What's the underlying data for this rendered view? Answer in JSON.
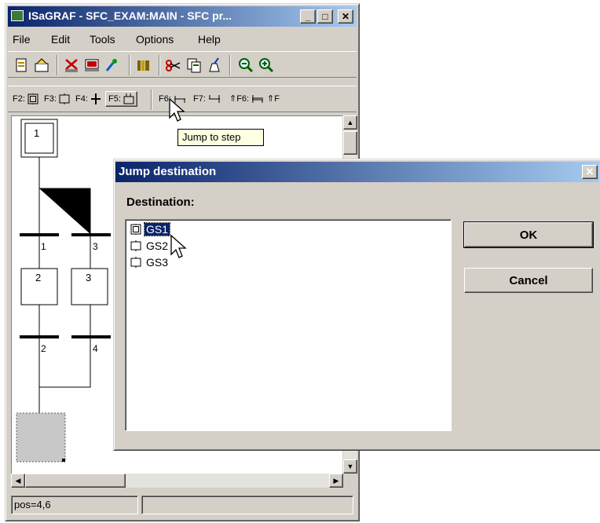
{
  "main_window": {
    "title": "ISaGRAF - SFC_EXAM:MAIN - SFC pr...",
    "minimize_glyph": "_",
    "maximize_glyph": "□",
    "close_glyph": "✕"
  },
  "menu": {
    "file": "File",
    "edit": "Edit",
    "tools": "Tools",
    "options": "Options",
    "help": "Help"
  },
  "toolbar": {
    "icons": [
      "new-page-icon",
      "save-icon",
      "cut-icon",
      "dictionary-icon",
      "brush-icon",
      "library-icon",
      "scissors-icon",
      "copy-icon",
      "paint-icon",
      "zoom-out-icon",
      "zoom-in-icon"
    ]
  },
  "sfc_toolbar": {
    "f2": "F2:",
    "f3": "F3:",
    "f4": "F4:",
    "f5": "F5:",
    "f6": "F6:",
    "f7": "F7:",
    "sf6": "⇑F6:",
    "sf_more": "⇑F"
  },
  "tooltip": {
    "text": "Jump to step"
  },
  "diagram": {
    "steps": [
      {
        "label": "1",
        "initial": true
      },
      {
        "label": "2"
      },
      {
        "label": "3"
      }
    ],
    "transitions": [
      "1",
      "3",
      "2",
      "4"
    ]
  },
  "status_bar": {
    "position": "pos=4,6",
    "secondary": ""
  },
  "dialog": {
    "title": "Jump destination",
    "close_glyph": "✕",
    "destination_label": "Destination:",
    "items": [
      {
        "label": "GS1",
        "selected": true,
        "kind": "initial-step"
      },
      {
        "label": "GS2",
        "selected": false,
        "kind": "step"
      },
      {
        "label": "GS3",
        "selected": false,
        "kind": "step"
      }
    ],
    "ok_label": "OK",
    "cancel_label": "Cancel"
  },
  "colors": {
    "titlebar_active": "#0a246a",
    "face": "#d4d0c8",
    "selection": "#0a246a",
    "tooltip_bg": "#ffffe1"
  }
}
